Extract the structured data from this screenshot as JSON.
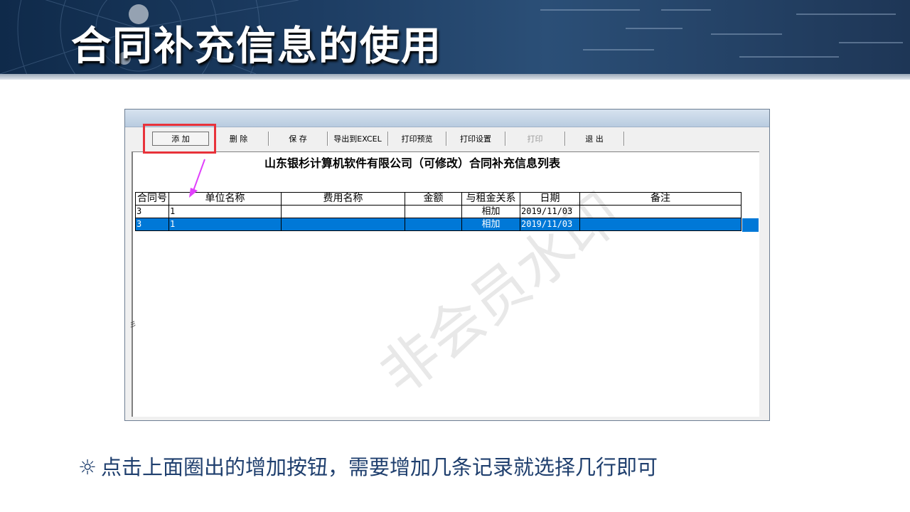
{
  "slide": {
    "title": "合同补充信息的使用",
    "bullet_icon": "☼",
    "bullet_text": "点击上面圈出的增加按钮，需要增加几条记录就选择几行即可",
    "watermark": "非会员水印",
    "colors": {
      "banner": "#1d3d63",
      "highlight": "#e8323a",
      "arrow": "#e040fb",
      "selection": "#0078d7",
      "bullet_text": "#1f3f6e"
    }
  },
  "toolbar": {
    "add": "添  加",
    "delete": "删  除",
    "save": "保  存",
    "export": "导出到EXCEL",
    "print_preview": "打印预览",
    "print_setup": "打印设置",
    "print": "打印",
    "exit": "退  出"
  },
  "report": {
    "title": "山东银杉计算机软件有限公司（可修改）合同补充信息列表",
    "columns": [
      "合同号",
      "单位名称",
      "费用名称",
      "金额",
      "与租金关系",
      "日期",
      "备注"
    ],
    "rows": [
      {
        "contract_no": "3",
        "unit": "1",
        "fee": "",
        "amount": "",
        "relation": "相加",
        "date": "2019/11/03",
        "note": ""
      },
      {
        "contract_no": "3",
        "unit": "1",
        "fee": "",
        "amount": "",
        "relation": "相加",
        "date": "2019/11/03",
        "note": ""
      }
    ],
    "side_mark": "彡"
  }
}
